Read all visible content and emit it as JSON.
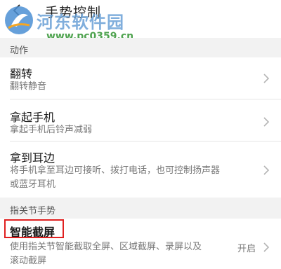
{
  "header": {
    "title": "手势控制"
  },
  "watermark": {
    "site_name": "河东软件园",
    "url": "www.pc0359.cn"
  },
  "sections": [
    {
      "label": "动作"
    },
    {
      "label": "指关节手势"
    }
  ],
  "rows": [
    {
      "title": "翻转",
      "subtitle": "翻转静音"
    },
    {
      "title": "拿起手机",
      "subtitle": "拿起手机后铃声减弱"
    },
    {
      "title": "拿到耳边",
      "subtitle_line1": "将手机拿至耳边可接听、拨打电话，也可控制扬声器",
      "subtitle_line2": "或蓝牙耳机"
    },
    {
      "title": "智能截屏",
      "subtitle_line1": "使用指关节智能截取全屏、区域截屏、录屏以及",
      "subtitle_line2": "滚动截屏",
      "status": "开启"
    }
  ],
  "colors": {
    "highlight_box": "#e02020",
    "watermark_text": "#6aa1d6",
    "watermark_url": "#3d9a3d"
  }
}
